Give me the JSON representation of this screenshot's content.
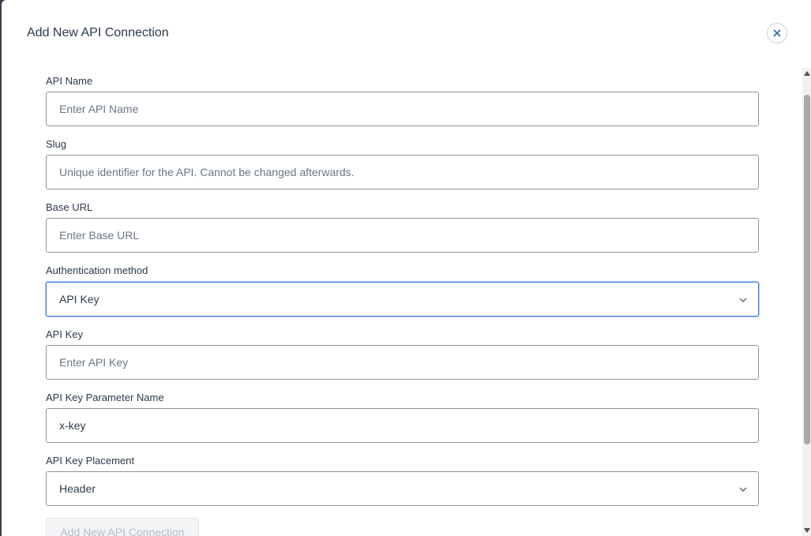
{
  "modal": {
    "title": "Add New API Connection",
    "close_icon": "close-icon"
  },
  "fields": {
    "api_name": {
      "label": "API Name",
      "placeholder": "Enter API Name",
      "value": ""
    },
    "slug": {
      "label": "Slug",
      "placeholder": "Unique identifier for the API. Cannot be changed afterwards.",
      "value": ""
    },
    "base_url": {
      "label": "Base URL",
      "placeholder": "Enter Base URL",
      "value": ""
    },
    "auth_method": {
      "label": "Authentication method",
      "value": "API Key"
    },
    "api_key": {
      "label": "API Key",
      "placeholder": "Enter API Key",
      "value": ""
    },
    "api_key_param": {
      "label": "API Key Parameter Name",
      "value": "x-key"
    },
    "api_key_placement": {
      "label": "API Key Placement",
      "value": "Header"
    }
  },
  "submit": {
    "label": "Add New API Connection"
  },
  "colors": {
    "accent_focus": "#3d7fe0",
    "border": "#8c95a0",
    "text": "#2c3a4b",
    "disabled_text": "#b8bec6"
  }
}
